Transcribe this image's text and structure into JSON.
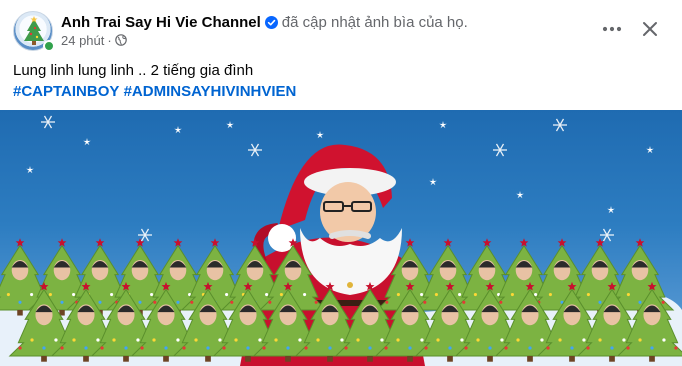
{
  "post": {
    "author": "Anh Trai Say Hi Vie Channel",
    "action": "đã cập nhật ảnh bìa của họ.",
    "time": "24 phút",
    "separator": "·",
    "audience_icon": "globe-icon",
    "verified_icon": "verified-badge-icon",
    "caption": "Lung linh lung linh .. 2 tiếng gia đình",
    "hashtags": [
      "#CAPTAINBOY",
      "#ADMINSAYHIVINHVIEN"
    ]
  },
  "header_actions": {
    "more_icon": "more-options-icon",
    "close_icon": "close-icon"
  },
  "colors": {
    "link_blue": "#0064d1",
    "verified_blue": "#0866ff",
    "secondary_text": "#65676b",
    "sky_blue": "#2d7dc1",
    "santa_red": "#c8102e",
    "tree_green": "#7cb342"
  }
}
